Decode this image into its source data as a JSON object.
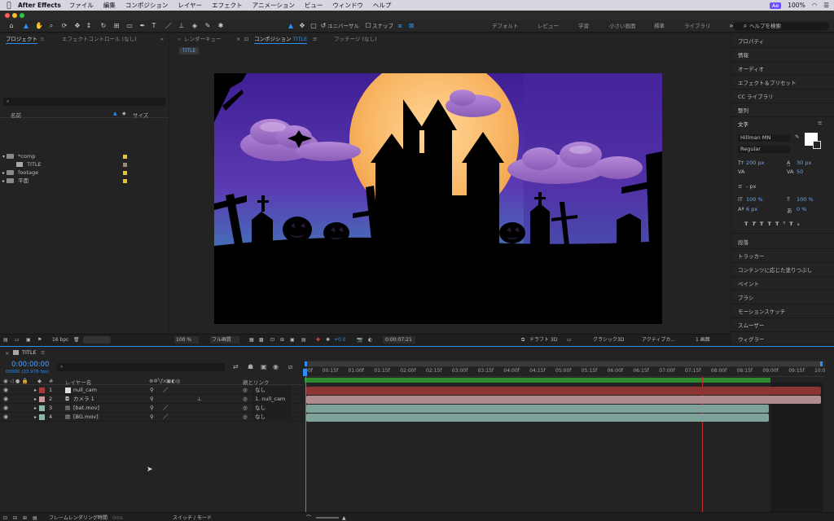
{
  "menubar": {
    "app": "After Effects",
    "items": [
      "ファイル",
      "編集",
      "コンポジション",
      "レイヤー",
      "エフェクト",
      "アニメーション",
      "ビュー",
      "ウィンドウ",
      "ヘルプ"
    ],
    "battery": "100%"
  },
  "toolbar": {
    "universal_label": "ユニバーサル",
    "snap_label": "スナップ",
    "workspaces": [
      "デフォルト",
      "レビュー",
      "学習",
      "小さい画面",
      "標準",
      "ライブラリ"
    ],
    "search_placeholder": "ヘルプを検索"
  },
  "project_panel": {
    "tab_project": "プロジェクト",
    "tab_effects": "エフェクトコントロール (なし)",
    "col_name": "名前",
    "col_size": "サイズ",
    "items": [
      {
        "name": "*comp",
        "type": "folder"
      },
      {
        "name": "TITLE",
        "type": "comp"
      },
      {
        "name": "footage",
        "type": "folder"
      },
      {
        "name": "平面",
        "type": "folder"
      }
    ],
    "bpc": "16 bpc"
  },
  "comp_panel": {
    "tab_render": "レンダーキュー",
    "tab_comp": "コンポジション",
    "comp_name": "TITLE",
    "tab_footage": "フッテージ (なし)",
    "breadcrumb": "TITLE",
    "zoom": "100 %",
    "quality": "フル画質",
    "exposure": "+0.0",
    "timecode": "0:00:07:21",
    "draft3d": "ドラフト 3D",
    "renderer": "クラシック3D",
    "camera": "アクティブカ...",
    "views": "1 画面"
  },
  "right_panel": {
    "items_top": [
      "プロパティ",
      "情報",
      "オーディオ",
      "エフェクト＆プリセット",
      "CC ライブラリ",
      "整列"
    ],
    "text_panel": {
      "title": "文字",
      "font": "Hillman MN",
      "style": "Regular",
      "size": "200 px",
      "leading": "30 px",
      "tracking": "50",
      "stroke": "- px",
      "vscale": "100 %",
      "hscale": "100 %",
      "baseline": "6 px",
      "tsume": "0 %"
    },
    "items_bottom": [
      "段落",
      "トラッカー",
      "コンテンツに応じた塗りつぶし",
      "ペイント",
      "ブラシ",
      "モーションスケッチ",
      "スムーザー",
      "ウィグラー"
    ]
  },
  "timeline": {
    "comp_name": "TITLE",
    "current_time": "0:00:00:00",
    "fps_label": "00000 (23.976 fps)",
    "col_layer": "レイヤー名",
    "col_parent": "親とリンク",
    "layers": [
      {
        "num": "1",
        "name": "null_cam",
        "parent": "なし",
        "color": "#a83a3a"
      },
      {
        "num": "2",
        "name": "カメラ 1",
        "parent": "1. null_cam",
        "color": "#c79aa0"
      },
      {
        "num": "3",
        "name": "[bat.mov]",
        "parent": "なし",
        "color": "#8fb5ad"
      },
      {
        "num": "4",
        "name": "[BG.mov]",
        "parent": "なし",
        "color": "#8fb5ad"
      }
    ],
    "ruler": [
      "00f",
      "00:15f",
      "01:00f",
      "01:15f",
      "02:00f",
      "02:15f",
      "03:00f",
      "03:15f",
      "04:00f",
      "04:15f",
      "05:00f",
      "05:15f",
      "06:00f",
      "06:15f",
      "07:00f",
      "07:15f",
      "08:00f",
      "08:15f",
      "09:00f",
      "09:15f",
      "10:0"
    ],
    "footer_render": "フレームレンダリング時間",
    "footer_render_value": "0ms",
    "footer_switch": "スイッチ / モード"
  }
}
